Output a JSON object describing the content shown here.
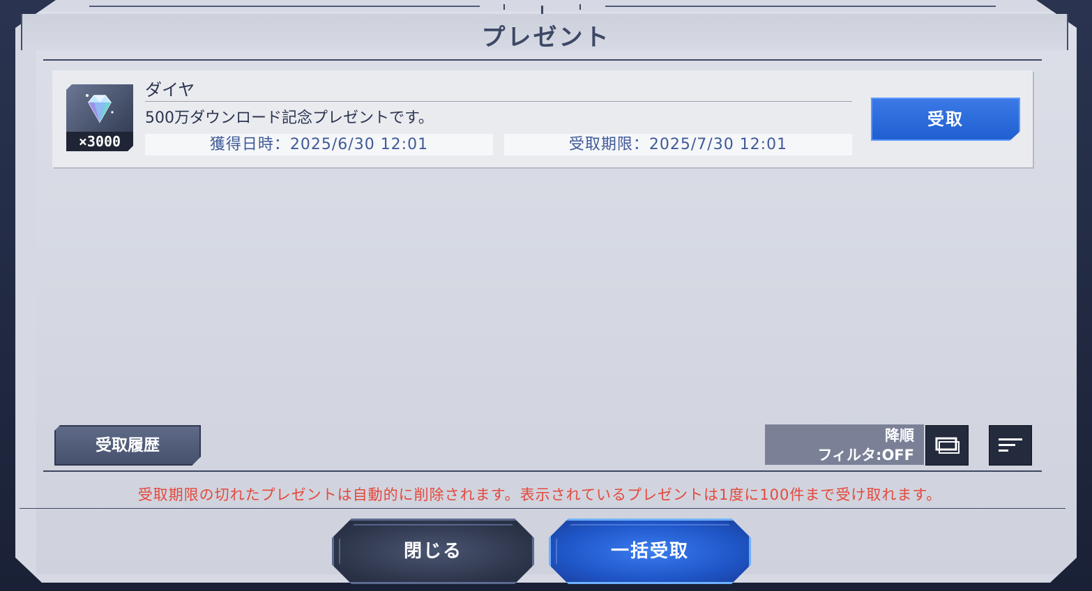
{
  "dialog": {
    "title": "プレゼント"
  },
  "present": {
    "item_name": "ダイヤ",
    "quantity": "×3000",
    "description": "500万ダウンロード記念プレゼントです。",
    "acquired_label": "獲得日時：2025/6/30 12:01",
    "deadline_label": "受取期限：2025/7/30 12:01",
    "receive_label": "受取"
  },
  "controls": {
    "history_label": "受取履歴",
    "sort_order": "降順",
    "filter_status": "フィルタ:OFF"
  },
  "notice": "受取期限の切れたプレゼントは自動的に削除されます。表示されているプレゼントは1度に100件まで受け取れます。",
  "buttons": {
    "close_label": "閉じる",
    "receive_all_label": "一括受取"
  },
  "colors": {
    "accent_blue": "#2666dc",
    "notice_red": "#e4493c",
    "panel_bg": "#d6d9e3",
    "frame_dark": "#1b2236"
  }
}
